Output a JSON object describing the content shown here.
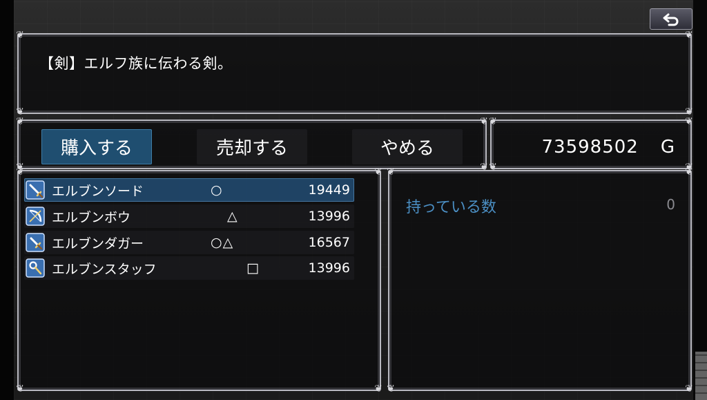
{
  "help": {
    "text": "【剣】エルフ族に伝わる剣。"
  },
  "back_button": {
    "icon": "return-arrow-icon"
  },
  "commands": [
    {
      "label": "購入する",
      "active": true
    },
    {
      "label": "売却する",
      "active": false
    },
    {
      "label": "やめる",
      "active": false
    }
  ],
  "gold": {
    "amount": "73598502",
    "unit": "G"
  },
  "items": [
    {
      "name": "エルブンソード",
      "mark": "○",
      "price": "19449",
      "icon": "sword-icon",
      "selected": true
    },
    {
      "name": "エルブンボウ",
      "mark": "△",
      "price": "13996",
      "icon": "bow-icon",
      "selected": false
    },
    {
      "name": "エルブンダガー",
      "mark": "○△",
      "price": "16567",
      "icon": "dagger-icon",
      "selected": false
    },
    {
      "name": "エルブンスタッフ",
      "mark": "□",
      "price": "13996",
      "icon": "staff-icon",
      "selected": false
    }
  ],
  "status": {
    "label": "持っている数",
    "value": "0"
  },
  "colors": {
    "selected_command": "#1f4e70",
    "selected_row": "#2c6eaa",
    "label_blue": "#4b8fc4"
  }
}
